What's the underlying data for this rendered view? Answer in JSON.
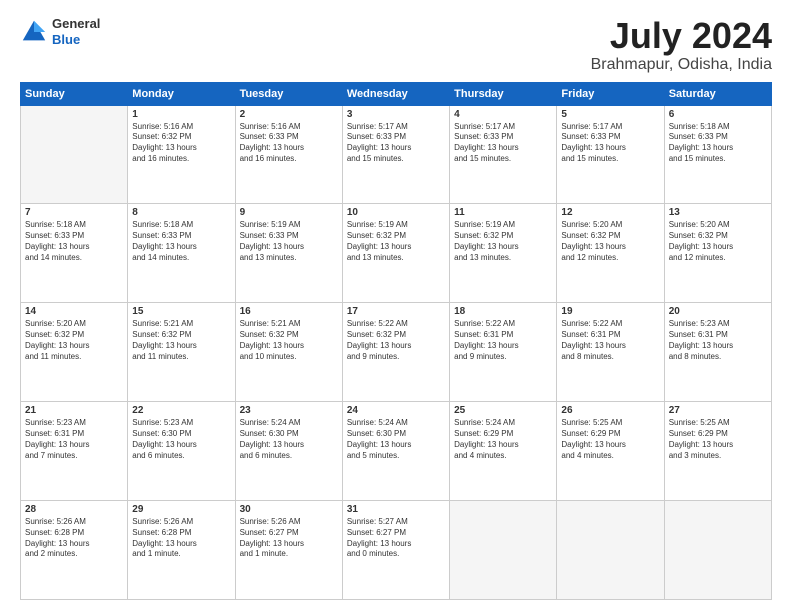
{
  "logo": {
    "general": "General",
    "blue": "Blue"
  },
  "header": {
    "title": "July 2024",
    "subtitle": "Brahmapur, Odisha, India"
  },
  "weekdays": [
    "Sunday",
    "Monday",
    "Tuesday",
    "Wednesday",
    "Thursday",
    "Friday",
    "Saturday"
  ],
  "weeks": [
    [
      {
        "day": "",
        "info": ""
      },
      {
        "day": "1",
        "info": "Sunrise: 5:16 AM\nSunset: 6:32 PM\nDaylight: 13 hours\nand 16 minutes."
      },
      {
        "day": "2",
        "info": "Sunrise: 5:16 AM\nSunset: 6:33 PM\nDaylight: 13 hours\nand 16 minutes."
      },
      {
        "day": "3",
        "info": "Sunrise: 5:17 AM\nSunset: 6:33 PM\nDaylight: 13 hours\nand 15 minutes."
      },
      {
        "day": "4",
        "info": "Sunrise: 5:17 AM\nSunset: 6:33 PM\nDaylight: 13 hours\nand 15 minutes."
      },
      {
        "day": "5",
        "info": "Sunrise: 5:17 AM\nSunset: 6:33 PM\nDaylight: 13 hours\nand 15 minutes."
      },
      {
        "day": "6",
        "info": "Sunrise: 5:18 AM\nSunset: 6:33 PM\nDaylight: 13 hours\nand 15 minutes."
      }
    ],
    [
      {
        "day": "7",
        "info": "Sunrise: 5:18 AM\nSunset: 6:33 PM\nDaylight: 13 hours\nand 14 minutes."
      },
      {
        "day": "8",
        "info": "Sunrise: 5:18 AM\nSunset: 6:33 PM\nDaylight: 13 hours\nand 14 minutes."
      },
      {
        "day": "9",
        "info": "Sunrise: 5:19 AM\nSunset: 6:33 PM\nDaylight: 13 hours\nand 13 minutes."
      },
      {
        "day": "10",
        "info": "Sunrise: 5:19 AM\nSunset: 6:32 PM\nDaylight: 13 hours\nand 13 minutes."
      },
      {
        "day": "11",
        "info": "Sunrise: 5:19 AM\nSunset: 6:32 PM\nDaylight: 13 hours\nand 13 minutes."
      },
      {
        "day": "12",
        "info": "Sunrise: 5:20 AM\nSunset: 6:32 PM\nDaylight: 13 hours\nand 12 minutes."
      },
      {
        "day": "13",
        "info": "Sunrise: 5:20 AM\nSunset: 6:32 PM\nDaylight: 13 hours\nand 12 minutes."
      }
    ],
    [
      {
        "day": "14",
        "info": "Sunrise: 5:20 AM\nSunset: 6:32 PM\nDaylight: 13 hours\nand 11 minutes."
      },
      {
        "day": "15",
        "info": "Sunrise: 5:21 AM\nSunset: 6:32 PM\nDaylight: 13 hours\nand 11 minutes."
      },
      {
        "day": "16",
        "info": "Sunrise: 5:21 AM\nSunset: 6:32 PM\nDaylight: 13 hours\nand 10 minutes."
      },
      {
        "day": "17",
        "info": "Sunrise: 5:22 AM\nSunset: 6:32 PM\nDaylight: 13 hours\nand 9 minutes."
      },
      {
        "day": "18",
        "info": "Sunrise: 5:22 AM\nSunset: 6:31 PM\nDaylight: 13 hours\nand 9 minutes."
      },
      {
        "day": "19",
        "info": "Sunrise: 5:22 AM\nSunset: 6:31 PM\nDaylight: 13 hours\nand 8 minutes."
      },
      {
        "day": "20",
        "info": "Sunrise: 5:23 AM\nSunset: 6:31 PM\nDaylight: 13 hours\nand 8 minutes."
      }
    ],
    [
      {
        "day": "21",
        "info": "Sunrise: 5:23 AM\nSunset: 6:31 PM\nDaylight: 13 hours\nand 7 minutes."
      },
      {
        "day": "22",
        "info": "Sunrise: 5:23 AM\nSunset: 6:30 PM\nDaylight: 13 hours\nand 6 minutes."
      },
      {
        "day": "23",
        "info": "Sunrise: 5:24 AM\nSunset: 6:30 PM\nDaylight: 13 hours\nand 6 minutes."
      },
      {
        "day": "24",
        "info": "Sunrise: 5:24 AM\nSunset: 6:30 PM\nDaylight: 13 hours\nand 5 minutes."
      },
      {
        "day": "25",
        "info": "Sunrise: 5:24 AM\nSunset: 6:29 PM\nDaylight: 13 hours\nand 4 minutes."
      },
      {
        "day": "26",
        "info": "Sunrise: 5:25 AM\nSunset: 6:29 PM\nDaylight: 13 hours\nand 4 minutes."
      },
      {
        "day": "27",
        "info": "Sunrise: 5:25 AM\nSunset: 6:29 PM\nDaylight: 13 hours\nand 3 minutes."
      }
    ],
    [
      {
        "day": "28",
        "info": "Sunrise: 5:26 AM\nSunset: 6:28 PM\nDaylight: 13 hours\nand 2 minutes."
      },
      {
        "day": "29",
        "info": "Sunrise: 5:26 AM\nSunset: 6:28 PM\nDaylight: 13 hours\nand 1 minute."
      },
      {
        "day": "30",
        "info": "Sunrise: 5:26 AM\nSunset: 6:27 PM\nDaylight: 13 hours\nand 1 minute."
      },
      {
        "day": "31",
        "info": "Sunrise: 5:27 AM\nSunset: 6:27 PM\nDaylight: 13 hours\nand 0 minutes."
      },
      {
        "day": "",
        "info": ""
      },
      {
        "day": "",
        "info": ""
      },
      {
        "day": "",
        "info": ""
      }
    ]
  ]
}
